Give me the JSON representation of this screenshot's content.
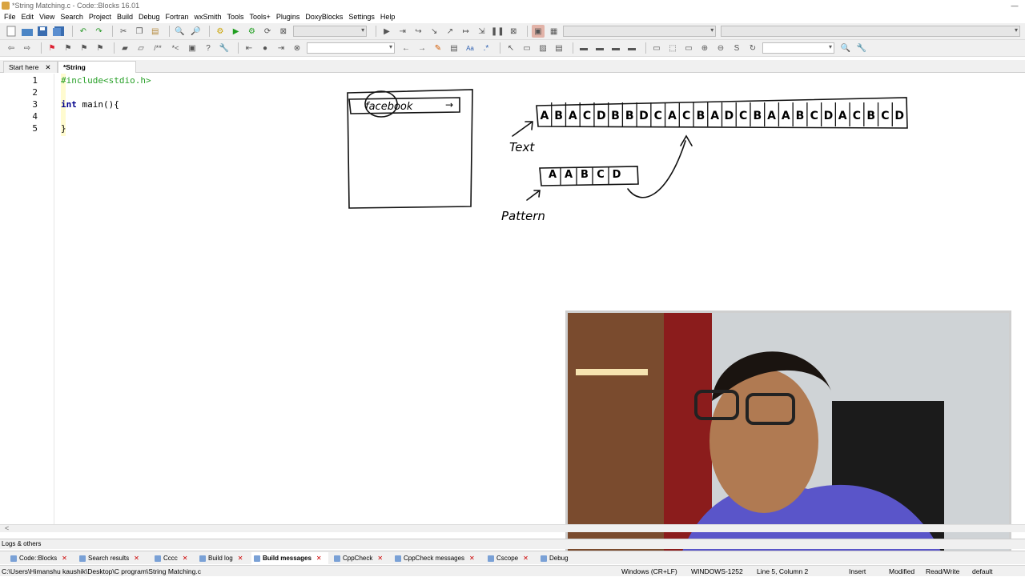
{
  "window": {
    "title": "*String Matching.c - Code::Blocks 16.01"
  },
  "menu": [
    "File",
    "Edit",
    "View",
    "Search",
    "Project",
    "Build",
    "Debug",
    "Fortran",
    "wxSmith",
    "Tools",
    "Tools+",
    "Plugins",
    "DoxyBlocks",
    "Settings",
    "Help"
  ],
  "tabs": [
    {
      "label": "Start here",
      "close": "✕"
    },
    {
      "label": "*String Matching.c",
      "close": "✕"
    }
  ],
  "editor": {
    "line_numbers": [
      "1",
      "2",
      "3",
      "4",
      "5"
    ],
    "lines": [
      {
        "pre": "#include<stdio.h>",
        "kw": "",
        "rest": ""
      },
      {
        "pre": "",
        "kw": "",
        "rest": ""
      },
      {
        "pre": "",
        "kw": "int",
        "rest": " main(){"
      },
      {
        "pre": "",
        "kw": "",
        "rest": ""
      },
      {
        "pre": "",
        "kw": "",
        "rest": "}"
      }
    ]
  },
  "drawing": {
    "browser_text": "facebook",
    "browser_arrow": "→",
    "text_cells": [
      "A",
      "B",
      "A",
      "C",
      "D",
      "B",
      "B",
      "D",
      "C",
      "A",
      "C",
      "B",
      "A",
      "D",
      "C",
      "B",
      "A",
      "A",
      "B",
      "C",
      "D",
      "A",
      "C",
      "B",
      "C",
      "D"
    ],
    "text_label": "Text",
    "pattern_cells": [
      "A",
      "A",
      "B",
      "C",
      "D"
    ],
    "pattern_label": "Pattern"
  },
  "logs_label": "Logs & others",
  "log_tabs": [
    {
      "label": "Code::Blocks",
      "close": "✕"
    },
    {
      "label": "Search results",
      "close": "✕"
    },
    {
      "label": "Cccc",
      "close": "✕"
    },
    {
      "label": "Build log",
      "close": "✕"
    },
    {
      "label": "Build messages",
      "close": "✕"
    },
    {
      "label": "CppCheck",
      "close": "✕"
    },
    {
      "label": "CppCheck messages",
      "close": "✕"
    },
    {
      "label": "Cscope",
      "close": "✕"
    },
    {
      "label": "Debug",
      "close": ""
    }
  ],
  "status": {
    "path": "C:\\Users\\Himanshu kaushik\\Desktop\\C program\\String Matching.c",
    "eol": "Windows (CR+LF)",
    "encoding": "WINDOWS-1252",
    "position": "Line 5, Column 2",
    "mode": "Insert",
    "modified": "Modified",
    "access": "Read/Write",
    "profile": "default"
  }
}
